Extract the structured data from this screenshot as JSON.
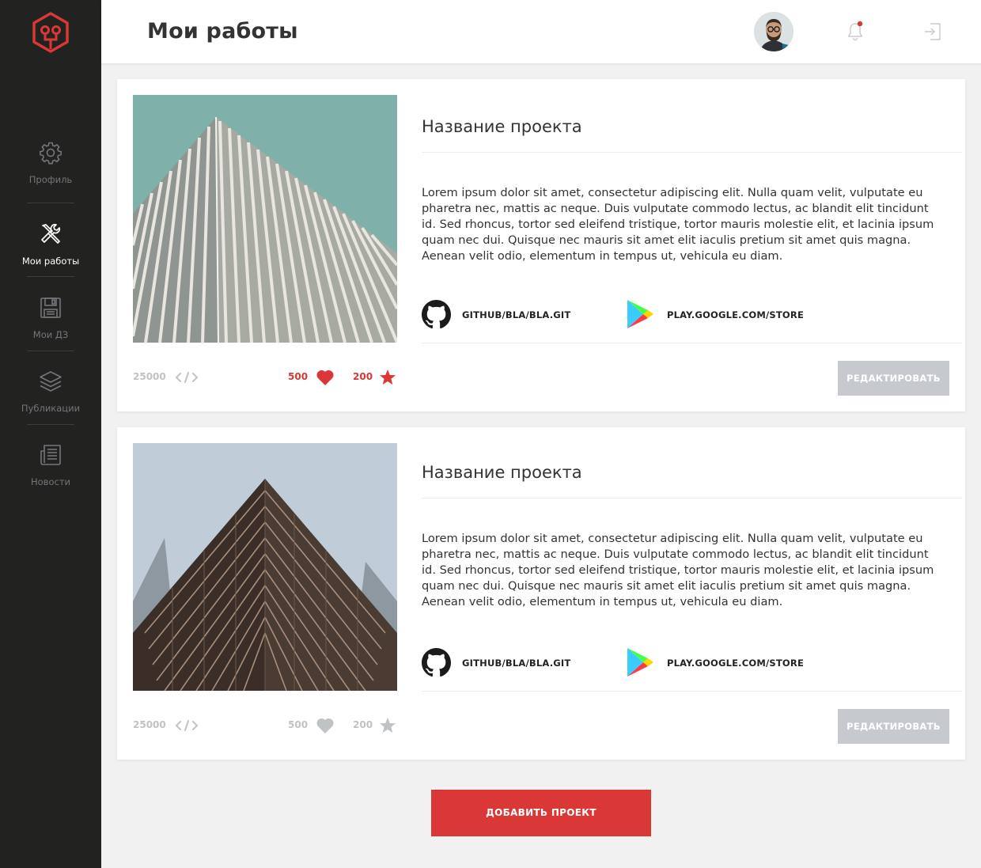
{
  "colors": {
    "accent": "#d93837",
    "sidebar_bg": "#222221",
    "page_bg": "#f1f1f1",
    "muted": "#c0c3c6"
  },
  "header": {
    "title": "Мои работы",
    "notification_dot": true
  },
  "sidebar": {
    "items": [
      {
        "label": "Профиль",
        "icon": "gear-icon",
        "active": false
      },
      {
        "label": "Мои работы",
        "icon": "tools-icon",
        "active": true
      },
      {
        "label": "Мои ДЗ",
        "icon": "floppy-icon",
        "active": false
      },
      {
        "label": "Публикации",
        "icon": "layers-icon",
        "active": false
      },
      {
        "label": "Новости",
        "icon": "newspaper-icon",
        "active": false
      }
    ]
  },
  "projects": [
    {
      "title": "Название проекта",
      "description": "Lorem ipsum dolor sit amet, consectetur adipiscing elit. Nulla quam velit, vulputate eu pharetra nec, mattis ac neque. Duis vulputate commodo lectus, ac blandit elit tincidunt id. Sed rhoncus, tortor sed eleifend tristique, tortor mauris molestie elit, et lacinia ipsum quam nec dui. Quisque nec mauris sit amet elit iaculis pretium sit amet quis magna. Aenean velit odio, elementum in tempus ut, vehicula eu diam.",
      "github": "GITHUB/BLA/BLA.GIT",
      "store": "PLAY.GOOGLE.COM/STORE",
      "code_count": "25000",
      "likes": "500",
      "stars": "200",
      "highlighted": true,
      "edit_label": "РЕДАКТИРОВАТЬ"
    },
    {
      "title": "Название проекта",
      "description": "Lorem ipsum dolor sit amet, consectetur adipiscing elit. Nulla quam velit, vulputate eu pharetra nec, mattis ac neque. Duis vulputate commodo lectus, ac blandit elit tincidunt id. Sed rhoncus, tortor sed eleifend tristique, tortor mauris molestie elit, et lacinia ipsum quam nec dui. Quisque nec mauris sit amet elit iaculis pretium sit amet quis magna. Aenean velit odio, elementum in tempus ut, vehicula eu diam.",
      "github": "GITHUB/BLA/BLA.GIT",
      "store": "PLAY.GOOGLE.COM/STORE",
      "code_count": "25000",
      "likes": "500",
      "stars": "200",
      "highlighted": false,
      "edit_label": "РЕДАКТИРОВАТЬ"
    }
  ],
  "add_button": "ДОБАВИТЬ ПРОЕКТ"
}
